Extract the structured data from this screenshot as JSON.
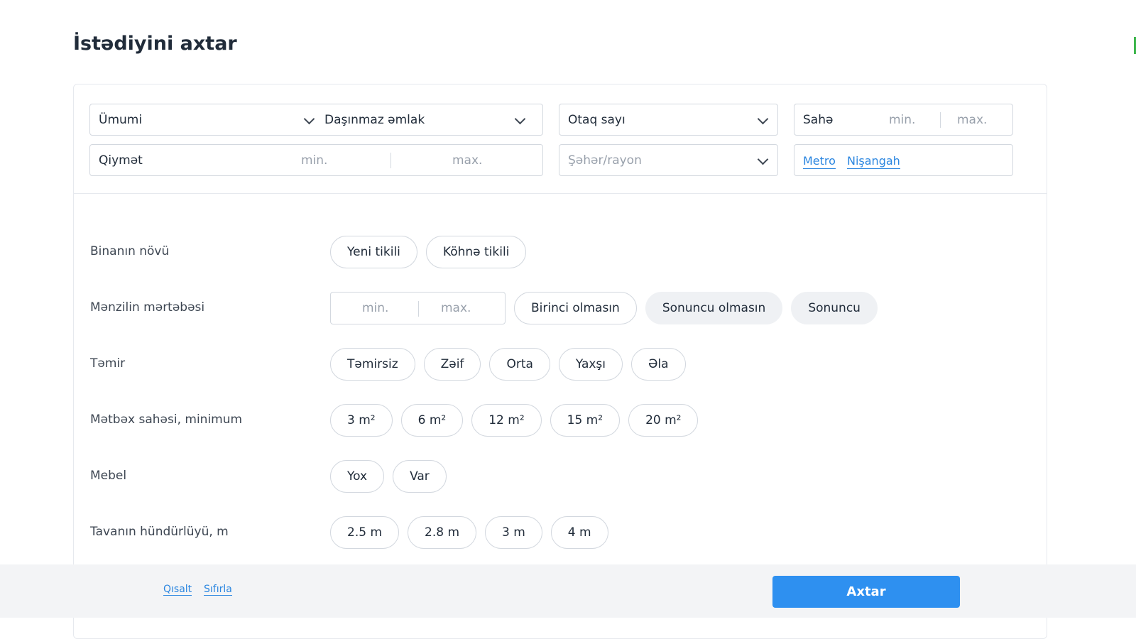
{
  "page": {
    "title": "İstədiyini axtar"
  },
  "search": {
    "category": "Ümumi",
    "property_type": "Daşınmaz əmlak",
    "rooms_placeholder": "Otaq sayı",
    "area_label": "Sahə",
    "area_min": "min.",
    "area_max": "max.",
    "price_label": "Qiymət",
    "price_min": "min.",
    "price_max": "max.",
    "city_placeholder": "Şəhər/rayon",
    "metro_link": "Metro",
    "landmark_link": "Nişangah"
  },
  "filters": {
    "building_type": {
      "label": "Binanın növü",
      "options": [
        "Yeni tikili",
        "Köhnə tikili"
      ]
    },
    "floor": {
      "label": "Mənzilin mərtəbəsi",
      "min": "min.",
      "max": "max.",
      "options": [
        "Birinci olmasın",
        "Sonuncu olmasın",
        "Sonuncu"
      ]
    },
    "repair": {
      "label": "Təmir",
      "options": [
        "Təmirsiz",
        "Zəif",
        "Orta",
        "Yaxşı",
        "Əla"
      ]
    },
    "kitchen": {
      "label": "Mətbəx sahəsi, minimum",
      "options": [
        "3 m²",
        "6 m²",
        "12 m²",
        "15 m²",
        "20 m²"
      ]
    },
    "furniture": {
      "label": "Mebel",
      "options": [
        "Yox",
        "Var"
      ]
    },
    "ceiling": {
      "label": "Tavanın hündürlüyü, m",
      "options": [
        "2.5 m",
        "2.8 m",
        "3 m",
        "4 m"
      ]
    }
  },
  "footer": {
    "collapse_link": "Qısalt",
    "reset_link": "Sıfırla",
    "search_button": "Axtar"
  },
  "colors": {
    "accent": "#2e90f0",
    "link": "#2b86e0",
    "border": "#d3d8df"
  }
}
